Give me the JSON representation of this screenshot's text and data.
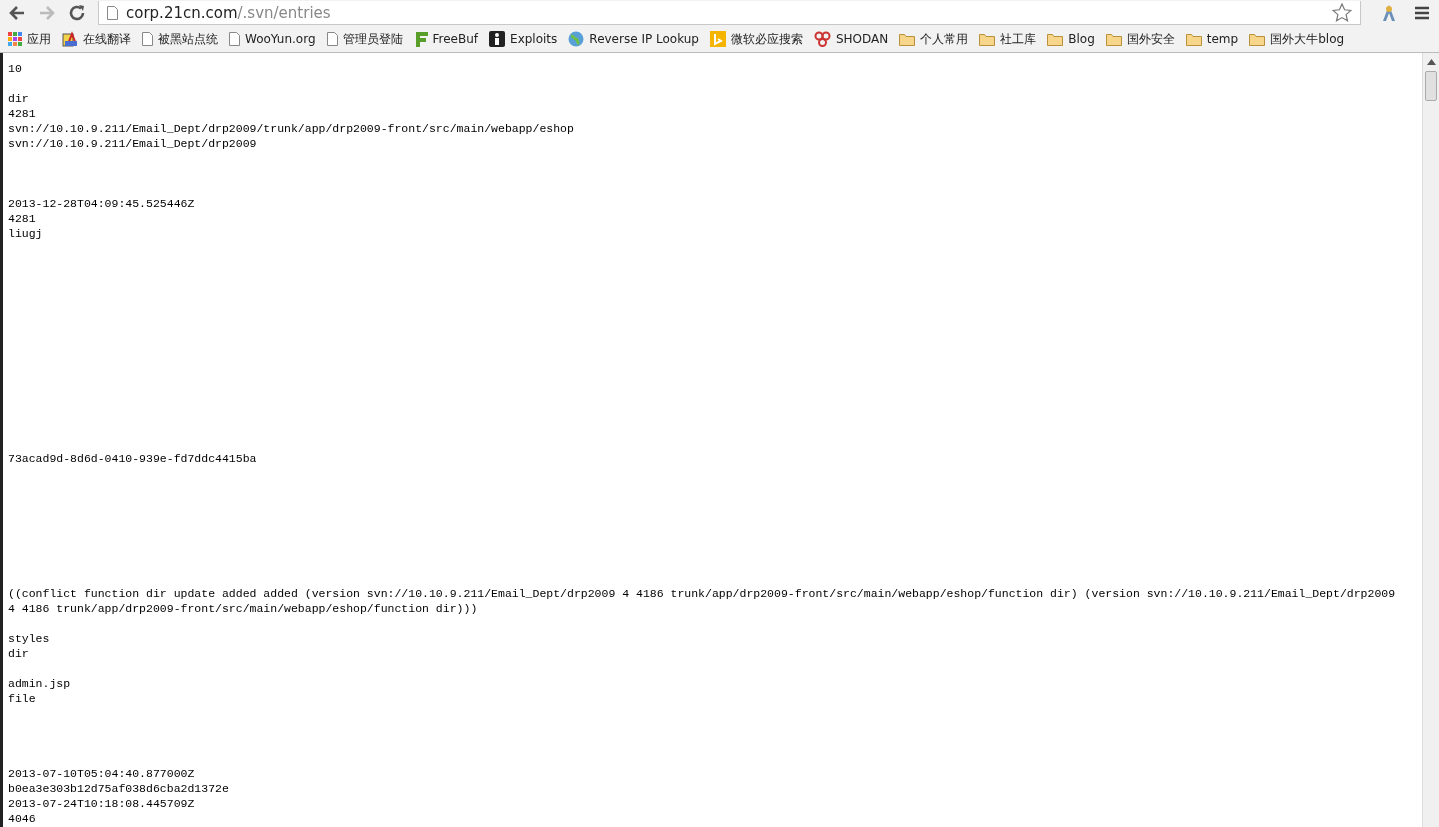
{
  "toolbar": {
    "url_host": "corp.21cn.com",
    "url_path": "/.svn/entries"
  },
  "bookmarks": [
    {
      "kind": "apps",
      "label": "应用"
    },
    {
      "kind": "translate",
      "label": "在线翻译"
    },
    {
      "kind": "page",
      "label": "被黑站点统"
    },
    {
      "kind": "page",
      "label": "WooYun.org"
    },
    {
      "kind": "page",
      "label": "管理员登陆"
    },
    {
      "kind": "freebuf",
      "label": "FreeBuf"
    },
    {
      "kind": "exploits",
      "label": "Exploits"
    },
    {
      "kind": "globe",
      "label": "Reverse IP Lookup"
    },
    {
      "kind": "bing",
      "label": "微软必应搜索"
    },
    {
      "kind": "shodan",
      "label": "SHODAN"
    },
    {
      "kind": "folder",
      "label": "个人常用"
    },
    {
      "kind": "folder",
      "label": "社工库"
    },
    {
      "kind": "folder",
      "label": "Blog"
    },
    {
      "kind": "folder",
      "label": "国外安全"
    },
    {
      "kind": "folder",
      "label": "temp"
    },
    {
      "kind": "folder",
      "label": "国外大牛blog"
    }
  ],
  "lines": [
    {
      "kind": "text",
      "text": "10"
    },
    {
      "kind": "blank"
    },
    {
      "kind": "text",
      "text": "dir"
    },
    {
      "kind": "text",
      "text": "4281"
    },
    {
      "kind": "text",
      "text": "svn://10.10.9.211/Email_Dept/drp2009/trunk/app/drp2009-front/src/main/webapp/eshop"
    },
    {
      "kind": "text",
      "text": "svn://10.10.9.211/Email_Dept/drp2009"
    },
    {
      "kind": "blank"
    },
    {
      "kind": "blank"
    },
    {
      "kind": "blank"
    },
    {
      "kind": "text",
      "text": "2013-12-28T04:09:45.525446Z"
    },
    {
      "kind": "text",
      "text": "4281"
    },
    {
      "kind": "text",
      "text": "liugj"
    },
    {
      "kind": "blank"
    },
    {
      "kind": "blank"
    },
    {
      "kind": "blank"
    },
    {
      "kind": "blank"
    },
    {
      "kind": "blank"
    },
    {
      "kind": "blank"
    },
    {
      "kind": "blank"
    },
    {
      "kind": "blank"
    },
    {
      "kind": "blank"
    },
    {
      "kind": "blank"
    },
    {
      "kind": "blank"
    },
    {
      "kind": "blank"
    },
    {
      "kind": "blank"
    },
    {
      "kind": "blank"
    },
    {
      "kind": "text",
      "text": "73acad9d-8d6d-0410-939e-fd7ddc4415ba"
    },
    {
      "kind": "blank"
    },
    {
      "kind": "blank"
    },
    {
      "kind": "blank"
    },
    {
      "kind": "blank"
    },
    {
      "kind": "blank"
    },
    {
      "kind": "blank"
    },
    {
      "kind": "blank"
    },
    {
      "kind": "blank"
    },
    {
      "kind": "text",
      "text": "((conflict function dir update added added (version svn://10.10.9.211/Email_Dept/drp2009 4 4186 trunk/app/drp2009-front/src/main/webapp/eshop/function dir) (version svn://10.10.9.211/Email_Dept/drp2009 4 4186 trunk/app/drp2009-front/src/main/webapp/eshop/function dir)))"
    },
    {
      "kind": "blank"
    },
    {
      "kind": "text",
      "text": "styles"
    },
    {
      "kind": "text",
      "text": "dir"
    },
    {
      "kind": "blank"
    },
    {
      "kind": "text",
      "text": "admin.jsp"
    },
    {
      "kind": "text",
      "text": "file"
    },
    {
      "kind": "blank"
    },
    {
      "kind": "blank"
    },
    {
      "kind": "blank"
    },
    {
      "kind": "blank"
    },
    {
      "kind": "text",
      "text": "2013-07-10T05:04:40.877000Z"
    },
    {
      "kind": "text",
      "text": "b0ea3e303b12d75af038d6cba2d1372e"
    },
    {
      "kind": "text",
      "text": "2013-07-24T10:18:08.445709Z"
    },
    {
      "kind": "text",
      "text": "4046"
    }
  ]
}
